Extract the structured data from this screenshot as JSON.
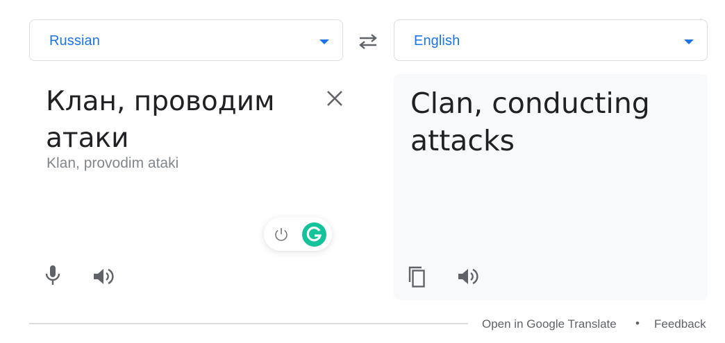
{
  "source_lang": {
    "label": "Russian",
    "icon": "chevron-down-icon",
    "color": "#1a73e8"
  },
  "target_lang": {
    "label": "English",
    "icon": "chevron-down-icon",
    "color": "#1a73e8"
  },
  "swap": {
    "icon": "swap-languages-icon"
  },
  "source": {
    "text": "Клан, проводим атаки",
    "transliteration": "Klan, provodim ataki",
    "clear_icon": "close-icon",
    "mic_icon": "microphone-icon",
    "listen_icon": "speaker-icon"
  },
  "grammarly": {
    "power_icon": "power-icon",
    "logo_icon": "grammarly-g-icon",
    "brand_color": "#15c39a"
  },
  "translation": {
    "text": "Clan, conducting attacks",
    "copy_icon": "copy-icon",
    "listen_icon": "speaker-icon"
  },
  "footer": {
    "open_link": "Open in Google Translate",
    "separator": "•",
    "feedback_link": "Feedback"
  }
}
